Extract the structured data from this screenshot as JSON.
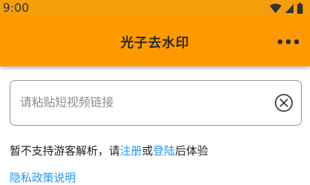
{
  "status_bar": {
    "time": "9:00",
    "icons": [
      "wifi-icon",
      "cellular-signal-icon",
      "battery-icon"
    ]
  },
  "app_bar": {
    "title": "光子去水印",
    "more_icon": "more-horizontal-icon"
  },
  "link_input": {
    "placeholder": "请粘贴短视频链接",
    "value": "",
    "clear_icon": "clear-circle-icon"
  },
  "notice": {
    "prefix": "暂不支持游客解析，请",
    "register_link": "注册",
    "middle": "或",
    "login_link": "登陆",
    "suffix": "后体验"
  },
  "privacy_link": "隐私政策说明",
  "colors": {
    "status_bar": "#f59e0b",
    "app_bar": "#fe9a00",
    "link": "#2196f3"
  }
}
